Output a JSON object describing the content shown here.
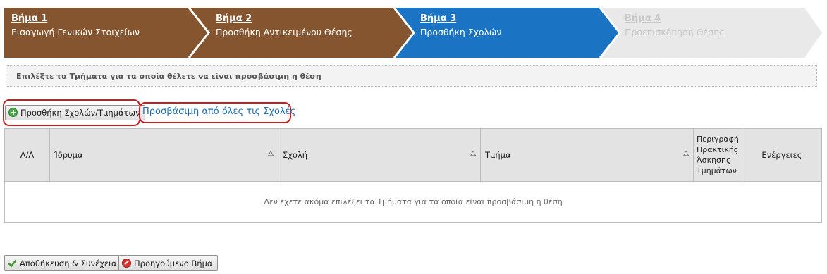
{
  "steps": [
    {
      "title": "Βήμα 1",
      "subtitle": "Εισαγωγή Γενικών Στοιχείων",
      "state": "done"
    },
    {
      "title": "Βήμα 2",
      "subtitle": "Προσθήκη Αντικειμένου Θέσης",
      "state": "done"
    },
    {
      "title": "Βήμα 3",
      "subtitle": "Προσθήκη Σχολών",
      "state": "active"
    },
    {
      "title": "Βήμα 4",
      "subtitle": "Προεπισκόπηση Θέσης",
      "state": "future"
    }
  ],
  "colors": {
    "done": "#84552f",
    "active": "#1a74c3",
    "future": "#e9e9e9"
  },
  "instruction": "Επιλέξτε τα Τμήματα για τα οποία θέλετε να είναι προσβάσιμη η θέση",
  "actions": {
    "add_label": "Προσθήκη Σχολών/Τμημάτων",
    "all_label": "Προσβάσιμη από όλες τις Σχολές"
  },
  "table": {
    "columns": {
      "index": "Α/Α",
      "institution": "Ίδρυμα",
      "school": "Σχολή",
      "department": "Τμήμα",
      "description": "Περιγραφή Πρακτικής Άσκησης Τμημάτων",
      "actions": "Ενέργειες"
    },
    "empty_message": "Δεν έχετε ακόμα επιλέξει τα Τμήματα για τα οποία είναι προσβάσιμη η θέση"
  },
  "footer": {
    "save_label": "Αποθήκευση & Συνέχεια",
    "prev_label": "Προηγούμενο Βήμα"
  }
}
